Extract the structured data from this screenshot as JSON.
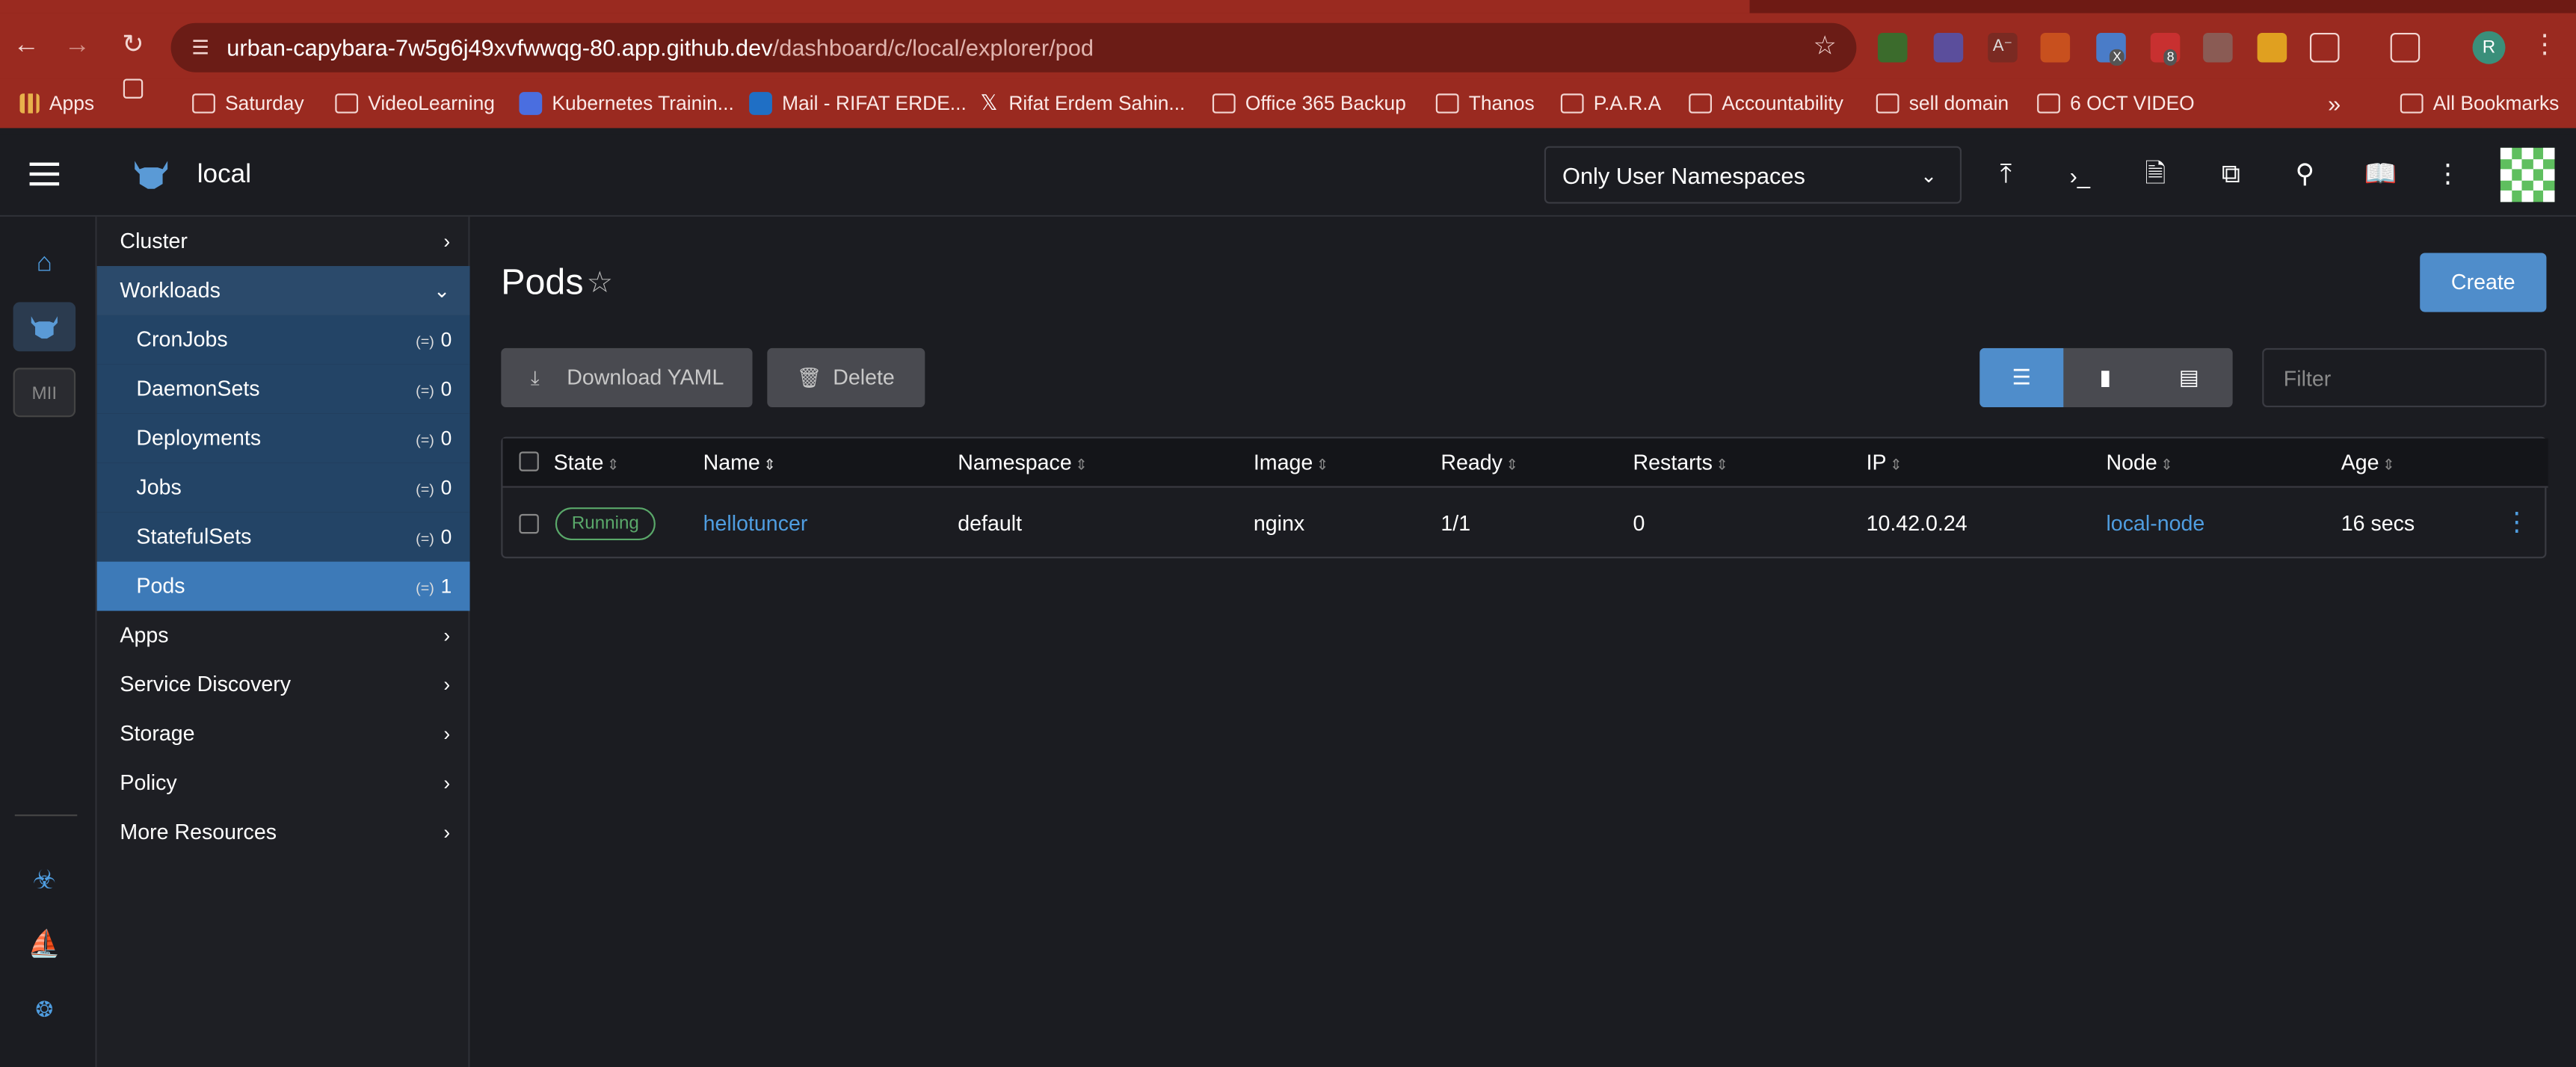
{
  "browser": {
    "url_host": "urban-capybara-7w5g6j49xvfwwqg-80.app.github.dev",
    "url_path": "/dashboard/c/local/explorer/pod",
    "ext_badges": [
      "X",
      "8"
    ],
    "profile_initial": "R",
    "bookmarks": [
      {
        "label": "Apps",
        "icon": "apps-grid-icon"
      },
      {
        "label": "Saturday",
        "icon": "folder-icon"
      },
      {
        "label": "VideoLearning",
        "icon": "folder-icon"
      },
      {
        "label": "Kubernetes Trainin...",
        "icon": "kubernetes-icon"
      },
      {
        "label": "Mail - RIFAT ERDE...",
        "icon": "outlook-icon"
      },
      {
        "label": "Rifat Erdem Sahin...",
        "icon": "x-logo-icon"
      },
      {
        "label": "Office 365 Backup",
        "icon": "folder-icon"
      },
      {
        "label": "Thanos",
        "icon": "folder-icon"
      },
      {
        "label": "P.A.R.A",
        "icon": "folder-icon"
      },
      {
        "label": "Accountability",
        "icon": "folder-icon"
      },
      {
        "label": "sell domain",
        "icon": "folder-icon"
      },
      {
        "label": "6 OCT VIDEO",
        "icon": "folder-icon"
      }
    ],
    "all_bookmarks": "All Bookmarks"
  },
  "header": {
    "cluster_name": "local",
    "namespace_filter": "Only User Namespaces",
    "buttons": [
      "upload-yaml-icon",
      "kubectl-shell-icon",
      "kubeconfig-download-icon",
      "copy-kubeconfig-icon",
      "search-icon",
      "docs-book-icon",
      "more-vertical-icon"
    ]
  },
  "rail": {
    "mii_label": "MII"
  },
  "sidenav": {
    "groups_top": [
      {
        "label": "Cluster"
      }
    ],
    "workloads": {
      "label": "Workloads",
      "items": [
        {
          "label": "CronJobs",
          "count": "0"
        },
        {
          "label": "DaemonSets",
          "count": "0"
        },
        {
          "label": "Deployments",
          "count": "0"
        },
        {
          "label": "Jobs",
          "count": "0"
        },
        {
          "label": "StatefulSets",
          "count": "0"
        },
        {
          "label": "Pods",
          "count": "1"
        }
      ]
    },
    "groups_bottom": [
      {
        "label": "Apps"
      },
      {
        "label": "Service Discovery"
      },
      {
        "label": "Storage"
      },
      {
        "label": "Policy"
      },
      {
        "label": "More Resources"
      }
    ]
  },
  "main": {
    "title": "Pods",
    "create_label": "Create",
    "download_label": "Download YAML",
    "delete_label": "Delete",
    "filter_placeholder": "Filter",
    "columns": [
      "State",
      "Name",
      "Namespace",
      "Image",
      "Ready",
      "Restarts",
      "IP",
      "Node",
      "Age"
    ],
    "rows": [
      {
        "state": "Running",
        "name": "hellotuncer",
        "namespace": "default",
        "image": "nginx",
        "ready": "1/1",
        "restarts": "0",
        "ip": "10.42.0.24",
        "node": "local-node",
        "age": "16 secs"
      }
    ]
  },
  "colors": {
    "browser_chrome": "#9a2a20",
    "accent": "#4f8dcb",
    "link": "#4f9de0",
    "running": "#5aa86a",
    "nav_open": "#2b4a6b",
    "nav_active": "#3d7ab8"
  }
}
